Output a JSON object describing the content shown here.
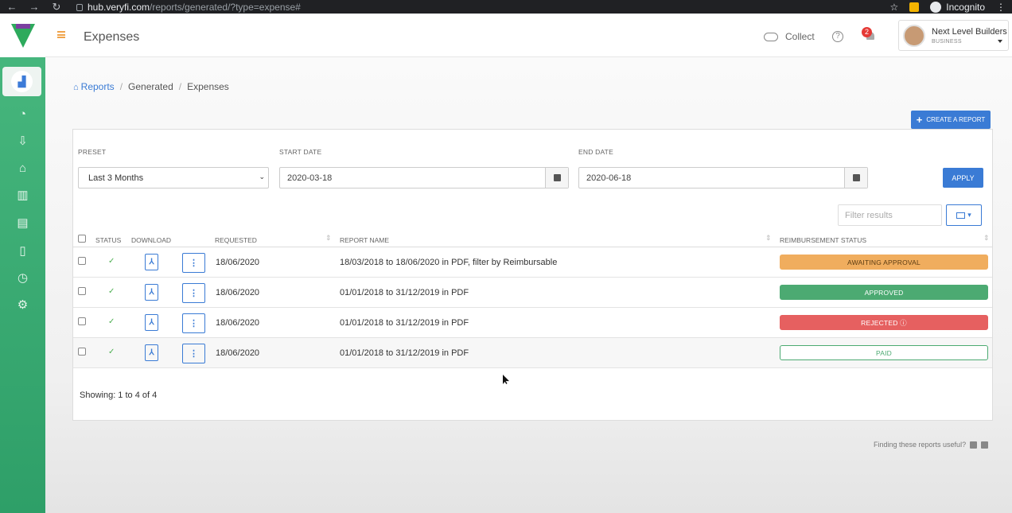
{
  "browser": {
    "url_host": "hub.veryfi.com",
    "url_path": "/reports/generated/?type=expense#",
    "profile_label": "Incognito"
  },
  "header": {
    "title": "Expenses",
    "collect_label": "Collect",
    "help_glyph": "?",
    "notification_count": "2",
    "account_name": "Next Level Builders",
    "account_plan": "BUSINESS"
  },
  "sidebar": {
    "items": [
      {
        "icon": "reports-icon",
        "active": true
      },
      {
        "icon": "analytics-pie-icon"
      },
      {
        "icon": "inbox-icon"
      },
      {
        "icon": "bank-icon"
      },
      {
        "icon": "bar-chart-icon"
      },
      {
        "icon": "archive-icon"
      },
      {
        "icon": "clipboard-icon"
      },
      {
        "icon": "clock-icon"
      },
      {
        "icon": "settings-gear-icon"
      }
    ]
  },
  "breadcrumb": {
    "root": "Reports",
    "middle": "Generated",
    "current": "Expenses"
  },
  "toolbar": {
    "create_label": "CREATE A REPORT"
  },
  "filters": {
    "preset_label": "PRESET",
    "preset_value": "Last 3 Months",
    "start_label": "START DATE",
    "start_value": "2020-03-18",
    "end_label": "END DATE",
    "end_value": "2020-06-18",
    "apply_label": "APPLY",
    "search_placeholder": "Filter results"
  },
  "table": {
    "headers": {
      "status": "STATUS",
      "download": "DOWNLOAD",
      "requested": "REQUESTED",
      "report_name": "REPORT NAME",
      "reimbursement": "REIMBURSEMENT STATUS"
    },
    "rows": [
      {
        "requested": "18/06/2020",
        "name": "18/03/2018 to 18/06/2020 in PDF, filter by Reimbursable",
        "status": "AWAITING APPROVAL",
        "status_color": "#f0ad5e",
        "status_text_color": "#5a3b12"
      },
      {
        "requested": "18/06/2020",
        "name": "01/01/2018 to 31/12/2019 in PDF",
        "status": "APPROVED",
        "status_color": "#4caa72",
        "status_text_color": "#ffffff"
      },
      {
        "requested": "18/06/2020",
        "name": "01/01/2018 to 31/12/2019 in PDF",
        "status": "REJECTED ⓘ",
        "status_color": "#e66060",
        "status_text_color": "#ffffff"
      },
      {
        "requested": "18/06/2020",
        "name": "01/01/2018 to 31/12/2019 in PDF",
        "status": "PAID",
        "status_color": "#ffffff",
        "status_text_color": "#4caa72"
      }
    ]
  },
  "footer": {
    "showing": "Showing: 1 to 4 of 4",
    "feedback_question": "Finding these reports useful?"
  },
  "colors": {
    "accent": "#3a7bd5",
    "sidebar_green": "#3aaa70",
    "hamburger_orange": "#f0a44b"
  }
}
